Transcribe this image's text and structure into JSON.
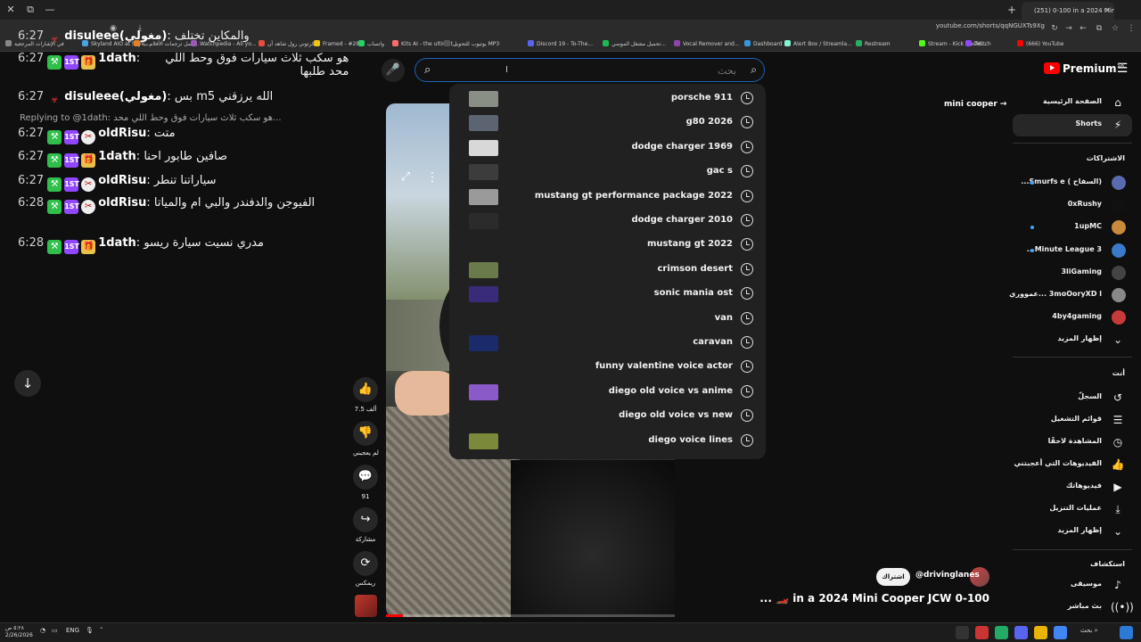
{
  "browser": {
    "active_tab_title": "(251) 0-100 in a 2024 Mini Cooper...",
    "url": "youtube.com/shorts/qqNGUXTs9Xg",
    "bookmarks": [
      {
        "label": "في الإشارات المرجعية",
        "color": "#888888"
      },
      {
        "label": "Skyland AIO at Skyn...",
        "color": "#4aa3df"
      },
      {
        "label": "حمل ترجمات الأفلام ب...",
        "color": "#e67e22"
      },
      {
        "label": "Watchpedia - All yo...",
        "color": "#9b59b6"
      },
      {
        "label": "كرتوني رول شاهد أن...",
        "color": "#e74c3c"
      },
      {
        "label": "Framed - #285",
        "color": "#f1c40f"
      },
      {
        "label": "واتساب",
        "color": "#25d366"
      },
      {
        "label": "Kits AI - the ultimat...",
        "color": "#ff6b6b"
      },
      {
        "label": "يوتيوب للتحويل MP3",
        "color": "#555555"
      },
      {
        "label": "Discord 19 - To-The...",
        "color": "#5865f2"
      },
      {
        "label": "تحميل مشغل الموسي...",
        "color": "#1db954"
      },
      {
        "label": "Vocal Remover and...",
        "color": "#8e44ad"
      },
      {
        "label": "Dashboard",
        "color": "#3498db"
      },
      {
        "label": "Alert Box / Streamla...",
        "color": "#80f5d2"
      },
      {
        "label": "Restream",
        "color": "#27ae60"
      },
      {
        "label": "Stream - Kick Dashb...",
        "color": "#53fc18"
      },
      {
        "label": "Twitch",
        "color": "#9146ff"
      },
      {
        "label": "(666) YouTube",
        "color": "#ff0000"
      }
    ]
  },
  "chat": {
    "messages": [
      {
        "time": "6:27",
        "user": "disuleee(مغولي)",
        "text": "والمكاين تختلف",
        "badges": [
          "red"
        ]
      },
      {
        "time": "6:27",
        "user": "1dath",
        "text": "هو سكب ثلاث سيارات فوق وحط اللي محد طلبها",
        "badges": [
          "green",
          "purple",
          "gift"
        ]
      },
      {
        "time": "6:27",
        "user": "disuleee(مغولي)",
        "text": "الله يرزقني m5 بس",
        "badges": [
          "red"
        ]
      },
      {
        "time": "6:27",
        "user": "oldRisu",
        "text": "متت",
        "badges": [
          "green",
          "purple",
          "wheel"
        ]
      },
      {
        "time": "6:27",
        "user": "1dath",
        "text": "صافين طابور احنا",
        "badges": [
          "green",
          "purple",
          "gift"
        ]
      },
      {
        "time": "6:27",
        "user": "oldRisu",
        "text": "سياراتنا تنطر",
        "badges": [
          "green",
          "purple",
          "wheel"
        ]
      },
      {
        "time": "6:28",
        "user": "oldRisu",
        "text": "الفيوجن والدفندر والبي ام والمياتا",
        "badges": [
          "green",
          "purple",
          "wheel"
        ]
      },
      {
        "time": "6:28",
        "user": "1dath",
        "text": "مدري نسيت سيارة ريسو",
        "badges": [
          "green",
          "purple",
          "gift"
        ]
      }
    ],
    "replying": "Replying to @1dath: هو سكب ثلاث سيارات فوق وحط اللي محد...",
    "badge_text": {
      "purple": "1ST"
    }
  },
  "search": {
    "placeholder": "بحث",
    "value": "",
    "suggestions": [
      {
        "label": "porsche 911",
        "thumb": "#8a8f86"
      },
      {
        "label": "g80 2026",
        "thumb": "#5b6470"
      },
      {
        "label": "dodge charger 1969",
        "thumb": "#d8d8d8"
      },
      {
        "label": "gac s",
        "thumb": "#3c3c3c"
      },
      {
        "label": "mustang gt performance package 2022",
        "thumb": "#9a9a9a"
      },
      {
        "label": "dodge charger 2010",
        "thumb": "#2b2b2b"
      },
      {
        "label": "mustang gt 2022",
        "thumb": ""
      },
      {
        "label": "crimson desert",
        "thumb": "#6b7a4a"
      },
      {
        "label": "sonic mania ost",
        "thumb": "#3a2a7a"
      },
      {
        "label": "van",
        "thumb": ""
      },
      {
        "label": "caravan",
        "thumb": "#1a2a6a"
      },
      {
        "label": "funny valentine voice actor",
        "thumb": ""
      },
      {
        "label": "diego old voice vs anime",
        "thumb": "#8a5ac8"
      },
      {
        "label": "diego old voice vs new",
        "thumb": ""
      },
      {
        "label": "diego voice lines",
        "thumb": "#7a8a3a"
      }
    ]
  },
  "video": {
    "title": "0-100 in a 2024 Mini Cooper JCW 🏎️ ...",
    "channel": "@drivinglanes",
    "subscribe": "اشتراك",
    "related_link": "mini cooper",
    "progress_fraction": 0.06,
    "actions": [
      {
        "name": "like-button",
        "icon": "👍",
        "label": "7.5 ألف"
      },
      {
        "name": "dislike-button",
        "icon": "👎",
        "label": "لم يعجبني"
      },
      {
        "name": "comments-button",
        "icon": "💬",
        "label": "91"
      },
      {
        "name": "share-button",
        "icon": "↪",
        "label": "مشاركة"
      },
      {
        "name": "remix-button",
        "icon": "⟳",
        "label": "ريمكس"
      }
    ]
  },
  "sidebar": {
    "logo": "Premium",
    "logo_region": "SA",
    "nav": [
      {
        "label": "الصفحة الرئيسية",
        "icon": "⌂"
      },
      {
        "label": "Shorts",
        "icon": "⚡"
      }
    ],
    "subscriptions_heading": "الاشتراكات",
    "subscriptions": [
      {
        "label": "(السفاح ) Smurfs e...",
        "color": "#5a6ab0",
        "live": true
      },
      {
        "label": "0xRushy",
        "color": "#111111",
        "live": false
      },
      {
        "label": "1upMC",
        "color": "#c98a3a",
        "live": true
      },
      {
        "label": "3 Minute League...",
        "color": "#3a7ac8",
        "live": true
      },
      {
        "label": "3liGaming",
        "color": "#444444",
        "live": false
      },
      {
        "label": "3moOoryXD l ...عمووري",
        "color": "#888888",
        "live": false
      },
      {
        "label": "4by4gaming",
        "color": "#c83a3a",
        "live": false
      }
    ],
    "show_more": "إظهار المزيد",
    "you_heading": "أنت",
    "you_items": [
      {
        "label": "السجلّ",
        "icon": "↺"
      },
      {
        "label": "قوائم التشغيل",
        "icon": "☰"
      },
      {
        "label": "المشاهدة لاحقًا",
        "icon": "◷"
      },
      {
        "label": "الفيديوهات التي أعجبتني",
        "icon": "👍"
      },
      {
        "label": "فيديوهاتك",
        "icon": "▶"
      },
      {
        "label": "عمليات التنزيل",
        "icon": "⤓"
      }
    ],
    "show_more_2": "إظهار المزيد",
    "explore_heading": "استكشاف",
    "explore_items": [
      {
        "label": "موسيقى",
        "icon": "♪"
      },
      {
        "label": "بث مباشر",
        "icon": "((•))"
      }
    ]
  },
  "taskbar": {
    "clock_time": "٥:٢٨ ص",
    "clock_date": "2/26/2026",
    "language": "ENG",
    "search_label": "بحث"
  }
}
